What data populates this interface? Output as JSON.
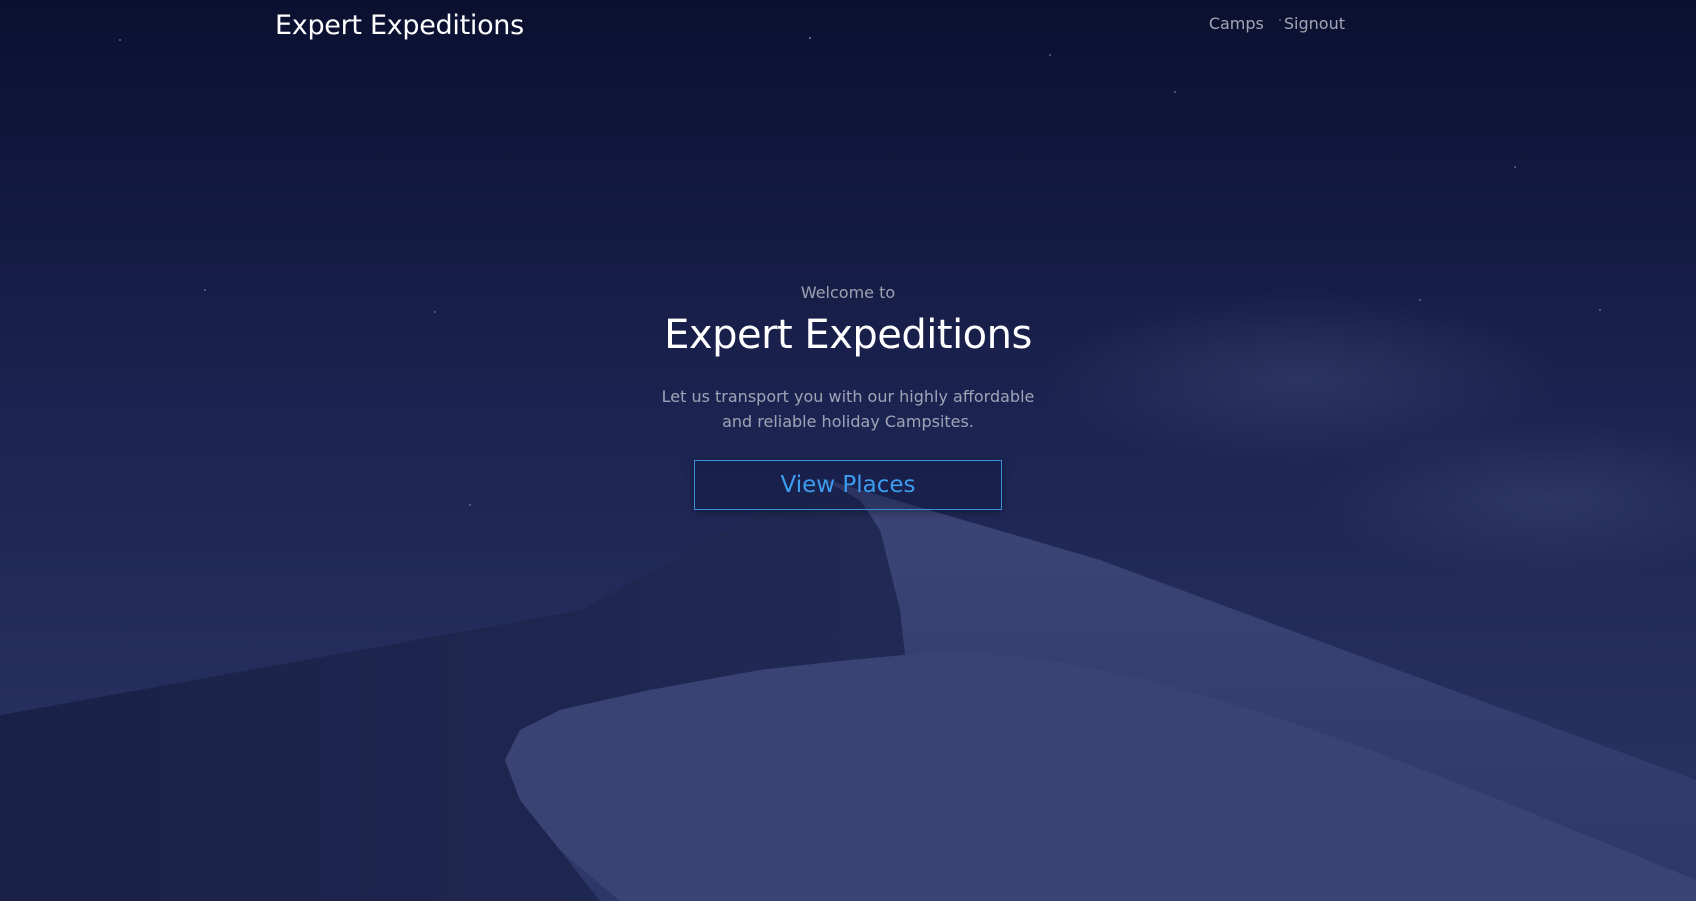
{
  "navbar": {
    "brand": "Expert Expeditions",
    "links": [
      {
        "label": "Camps"
      },
      {
        "label": "Signout"
      }
    ]
  },
  "hero": {
    "welcome": "Welcome to",
    "title": "Expert Expeditions",
    "tagline": "Let us transport you with our highly affordable and reliable holiday Campsites.",
    "button_label": "View Places"
  },
  "background": {
    "description_icon": "desert-dune-night-image",
    "sky_top_color": "#0b1030",
    "sky_bottom_color": "#2a3462",
    "accent_color": "#3d9cf0"
  }
}
